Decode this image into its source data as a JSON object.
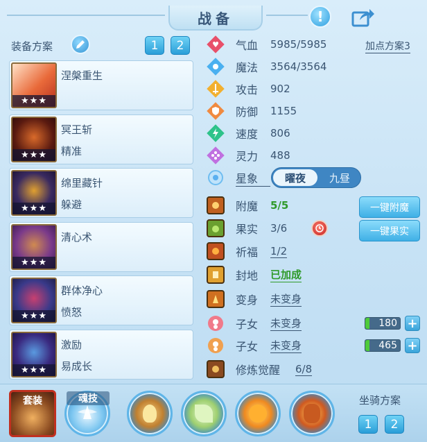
{
  "header": {
    "title": "战备",
    "help_icon": "exclamation-icon",
    "share_icon": "share-icon"
  },
  "equipment": {
    "section_label": "装备方案",
    "schemes": [
      "1",
      "2"
    ],
    "items": [
      {
        "name": "涅槃重生",
        "sub": "",
        "stars": "★★★"
      },
      {
        "name": "冥王斩",
        "sub": "精准",
        "stars": "★★★"
      },
      {
        "name": "绵里藏针",
        "sub": "躲避",
        "stars": "★★★"
      },
      {
        "name": "清心术",
        "sub": "",
        "stars": "★★★"
      },
      {
        "name": "群体净心",
        "sub": "愤怒",
        "stars": "★★★"
      },
      {
        "name": "激励",
        "sub": "易成长",
        "stars": "★★★"
      }
    ]
  },
  "stats": {
    "point_plan_link": "加点方案3",
    "rows": [
      {
        "name": "气血",
        "value": "5985/5985"
      },
      {
        "name": "魔法",
        "value": "3564/3564"
      },
      {
        "name": "攻击",
        "value": "902"
      },
      {
        "name": "防御",
        "value": "1155"
      },
      {
        "name": "速度",
        "value": "806"
      },
      {
        "name": "灵力",
        "value": "488"
      }
    ],
    "star": {
      "label": "星象",
      "options": [
        "曜夜",
        "九昼"
      ],
      "selected": "曜夜"
    }
  },
  "enhance": {
    "rows": [
      {
        "name": "附魔",
        "value": "5/5"
      },
      {
        "name": "果实",
        "value": "3/6"
      },
      {
        "name": "祈福",
        "value": "1/2"
      },
      {
        "name": "封地",
        "value": "已加成"
      },
      {
        "name": "变身",
        "value": "未变身"
      },
      {
        "name": "子女",
        "value": "未变身",
        "level": "180"
      },
      {
        "name": "子女",
        "value": "未变身",
        "level": "465"
      },
      {
        "name": "修炼觉醒",
        "value": "6/8"
      }
    ],
    "btn_enchant": "一键附魔",
    "btn_fruit": "一键果实"
  },
  "bottom": {
    "suit_label": "套装",
    "soul_label": "魂技",
    "mount_label": "坐骑方案",
    "mount_schemes": [
      "1",
      "2"
    ]
  }
}
